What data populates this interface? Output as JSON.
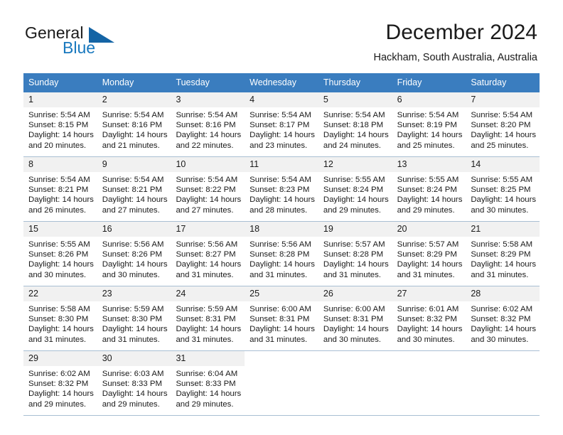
{
  "logo": {
    "word_one": "General",
    "word_two": "Blue",
    "mark": "triangle-mark",
    "color_primary": "#1464a5",
    "color_text": "#1878be"
  },
  "header": {
    "title": "December 2024",
    "location": "Hackham, South Australia, Australia"
  },
  "calendar": {
    "accent_color": "#3a7dbf",
    "day_band_color": "#f1f1f1",
    "weekdays": [
      "Sunday",
      "Monday",
      "Tuesday",
      "Wednesday",
      "Thursday",
      "Friday",
      "Saturday"
    ],
    "weeks": [
      [
        {
          "day": "1",
          "sunrise": "Sunrise: 5:54 AM",
          "sunset": "Sunset: 8:15 PM",
          "daylight_line1": "Daylight: 14 hours",
          "daylight_line2": "and 20 minutes."
        },
        {
          "day": "2",
          "sunrise": "Sunrise: 5:54 AM",
          "sunset": "Sunset: 8:16 PM",
          "daylight_line1": "Daylight: 14 hours",
          "daylight_line2": "and 21 minutes."
        },
        {
          "day": "3",
          "sunrise": "Sunrise: 5:54 AM",
          "sunset": "Sunset: 8:16 PM",
          "daylight_line1": "Daylight: 14 hours",
          "daylight_line2": "and 22 minutes."
        },
        {
          "day": "4",
          "sunrise": "Sunrise: 5:54 AM",
          "sunset": "Sunset: 8:17 PM",
          "daylight_line1": "Daylight: 14 hours",
          "daylight_line2": "and 23 minutes."
        },
        {
          "day": "5",
          "sunrise": "Sunrise: 5:54 AM",
          "sunset": "Sunset: 8:18 PM",
          "daylight_line1": "Daylight: 14 hours",
          "daylight_line2": "and 24 minutes."
        },
        {
          "day": "6",
          "sunrise": "Sunrise: 5:54 AM",
          "sunset": "Sunset: 8:19 PM",
          "daylight_line1": "Daylight: 14 hours",
          "daylight_line2": "and 25 minutes."
        },
        {
          "day": "7",
          "sunrise": "Sunrise: 5:54 AM",
          "sunset": "Sunset: 8:20 PM",
          "daylight_line1": "Daylight: 14 hours",
          "daylight_line2": "and 25 minutes."
        }
      ],
      [
        {
          "day": "8",
          "sunrise": "Sunrise: 5:54 AM",
          "sunset": "Sunset: 8:21 PM",
          "daylight_line1": "Daylight: 14 hours",
          "daylight_line2": "and 26 minutes."
        },
        {
          "day": "9",
          "sunrise": "Sunrise: 5:54 AM",
          "sunset": "Sunset: 8:21 PM",
          "daylight_line1": "Daylight: 14 hours",
          "daylight_line2": "and 27 minutes."
        },
        {
          "day": "10",
          "sunrise": "Sunrise: 5:54 AM",
          "sunset": "Sunset: 8:22 PM",
          "daylight_line1": "Daylight: 14 hours",
          "daylight_line2": "and 27 minutes."
        },
        {
          "day": "11",
          "sunrise": "Sunrise: 5:54 AM",
          "sunset": "Sunset: 8:23 PM",
          "daylight_line1": "Daylight: 14 hours",
          "daylight_line2": "and 28 minutes."
        },
        {
          "day": "12",
          "sunrise": "Sunrise: 5:55 AM",
          "sunset": "Sunset: 8:24 PM",
          "daylight_line1": "Daylight: 14 hours",
          "daylight_line2": "and 29 minutes."
        },
        {
          "day": "13",
          "sunrise": "Sunrise: 5:55 AM",
          "sunset": "Sunset: 8:24 PM",
          "daylight_line1": "Daylight: 14 hours",
          "daylight_line2": "and 29 minutes."
        },
        {
          "day": "14",
          "sunrise": "Sunrise: 5:55 AM",
          "sunset": "Sunset: 8:25 PM",
          "daylight_line1": "Daylight: 14 hours",
          "daylight_line2": "and 30 minutes."
        }
      ],
      [
        {
          "day": "15",
          "sunrise": "Sunrise: 5:55 AM",
          "sunset": "Sunset: 8:26 PM",
          "daylight_line1": "Daylight: 14 hours",
          "daylight_line2": "and 30 minutes."
        },
        {
          "day": "16",
          "sunrise": "Sunrise: 5:56 AM",
          "sunset": "Sunset: 8:26 PM",
          "daylight_line1": "Daylight: 14 hours",
          "daylight_line2": "and 30 minutes."
        },
        {
          "day": "17",
          "sunrise": "Sunrise: 5:56 AM",
          "sunset": "Sunset: 8:27 PM",
          "daylight_line1": "Daylight: 14 hours",
          "daylight_line2": "and 31 minutes."
        },
        {
          "day": "18",
          "sunrise": "Sunrise: 5:56 AM",
          "sunset": "Sunset: 8:28 PM",
          "daylight_line1": "Daylight: 14 hours",
          "daylight_line2": "and 31 minutes."
        },
        {
          "day": "19",
          "sunrise": "Sunrise: 5:57 AM",
          "sunset": "Sunset: 8:28 PM",
          "daylight_line1": "Daylight: 14 hours",
          "daylight_line2": "and 31 minutes."
        },
        {
          "day": "20",
          "sunrise": "Sunrise: 5:57 AM",
          "sunset": "Sunset: 8:29 PM",
          "daylight_line1": "Daylight: 14 hours",
          "daylight_line2": "and 31 minutes."
        },
        {
          "day": "21",
          "sunrise": "Sunrise: 5:58 AM",
          "sunset": "Sunset: 8:29 PM",
          "daylight_line1": "Daylight: 14 hours",
          "daylight_line2": "and 31 minutes."
        }
      ],
      [
        {
          "day": "22",
          "sunrise": "Sunrise: 5:58 AM",
          "sunset": "Sunset: 8:30 PM",
          "daylight_line1": "Daylight: 14 hours",
          "daylight_line2": "and 31 minutes."
        },
        {
          "day": "23",
          "sunrise": "Sunrise: 5:59 AM",
          "sunset": "Sunset: 8:30 PM",
          "daylight_line1": "Daylight: 14 hours",
          "daylight_line2": "and 31 minutes."
        },
        {
          "day": "24",
          "sunrise": "Sunrise: 5:59 AM",
          "sunset": "Sunset: 8:31 PM",
          "daylight_line1": "Daylight: 14 hours",
          "daylight_line2": "and 31 minutes."
        },
        {
          "day": "25",
          "sunrise": "Sunrise: 6:00 AM",
          "sunset": "Sunset: 8:31 PM",
          "daylight_line1": "Daylight: 14 hours",
          "daylight_line2": "and 31 minutes."
        },
        {
          "day": "26",
          "sunrise": "Sunrise: 6:00 AM",
          "sunset": "Sunset: 8:31 PM",
          "daylight_line1": "Daylight: 14 hours",
          "daylight_line2": "and 30 minutes."
        },
        {
          "day": "27",
          "sunrise": "Sunrise: 6:01 AM",
          "sunset": "Sunset: 8:32 PM",
          "daylight_line1": "Daylight: 14 hours",
          "daylight_line2": "and 30 minutes."
        },
        {
          "day": "28",
          "sunrise": "Sunrise: 6:02 AM",
          "sunset": "Sunset: 8:32 PM",
          "daylight_line1": "Daylight: 14 hours",
          "daylight_line2": "and 30 minutes."
        }
      ],
      [
        {
          "day": "29",
          "sunrise": "Sunrise: 6:02 AM",
          "sunset": "Sunset: 8:32 PM",
          "daylight_line1": "Daylight: 14 hours",
          "daylight_line2": "and 29 minutes."
        },
        {
          "day": "30",
          "sunrise": "Sunrise: 6:03 AM",
          "sunset": "Sunset: 8:33 PM",
          "daylight_line1": "Daylight: 14 hours",
          "daylight_line2": "and 29 minutes."
        },
        {
          "day": "31",
          "sunrise": "Sunrise: 6:04 AM",
          "sunset": "Sunset: 8:33 PM",
          "daylight_line1": "Daylight: 14 hours",
          "daylight_line2": "and 29 minutes."
        },
        {
          "day": "",
          "sunrise": "",
          "sunset": "",
          "daylight_line1": "",
          "daylight_line2": ""
        },
        {
          "day": "",
          "sunrise": "",
          "sunset": "",
          "daylight_line1": "",
          "daylight_line2": ""
        },
        {
          "day": "",
          "sunrise": "",
          "sunset": "",
          "daylight_line1": "",
          "daylight_line2": ""
        },
        {
          "day": "",
          "sunrise": "",
          "sunset": "",
          "daylight_line1": "",
          "daylight_line2": ""
        }
      ]
    ]
  }
}
